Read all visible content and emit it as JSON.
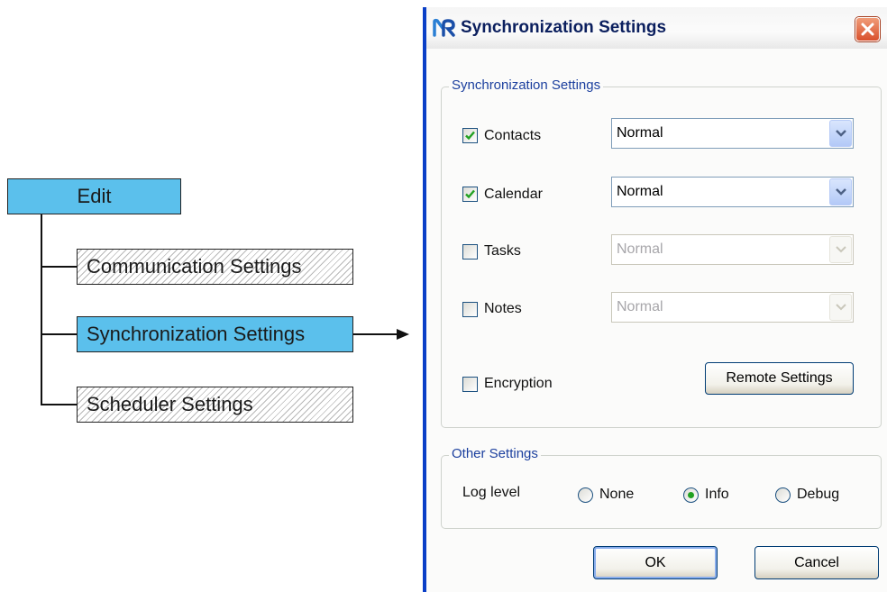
{
  "tree": {
    "root": "Edit",
    "children": [
      "Communication Settings",
      "Synchronization Settings",
      "Scheduler Settings"
    ]
  },
  "dialog": {
    "title": "Synchronization Settings",
    "sync_group": {
      "legend": "Synchronization Settings",
      "items": [
        {
          "label": "Contacts",
          "checked": true,
          "mode": "Normal",
          "enabled": true
        },
        {
          "label": "Calendar",
          "checked": true,
          "mode": "Normal",
          "enabled": true
        },
        {
          "label": "Tasks",
          "checked": false,
          "mode": "Normal",
          "enabled": false
        },
        {
          "label": "Notes",
          "checked": false,
          "mode": "Normal",
          "enabled": false
        }
      ],
      "encryption": {
        "label": "Encryption",
        "checked": false
      },
      "remote_settings_label": "Remote Settings"
    },
    "other_group": {
      "legend": "Other Settings",
      "log_level_label": "Log level",
      "options": [
        "None",
        "Info",
        "Debug"
      ],
      "selected": "Info"
    },
    "ok_label": "OK",
    "cancel_label": "Cancel"
  }
}
